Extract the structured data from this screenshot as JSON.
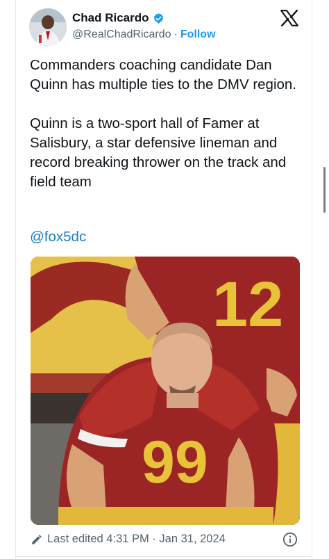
{
  "author": {
    "name": "Chad Ricardo",
    "handle": "@RealChadRicardo",
    "separator": "·",
    "follow_label": "Follow",
    "verified_icon": "verified-badge-icon",
    "brand_color": "#1d9bf0"
  },
  "post": {
    "paragraph_1": "Commanders coaching candidate Dan Quinn has multiple ties to the DMV region.",
    "paragraph_2": "Quinn is a two-sport hall of Famer at Salisbury, a star defensive lineman and record breaking thrower on the track and field team",
    "mention": "@fox5dc",
    "mention_color": "#1d7fc1"
  },
  "photo": {
    "jersey_back_number": "12",
    "jersey_front_number": "99",
    "jersey_color": "#9b2424",
    "number_color": "#e8c33a"
  },
  "footer": {
    "edit_icon": "pencil-icon",
    "edited_text": "Last edited 4:31 PM · Jan 31, 2024",
    "info_icon": "info-icon"
  }
}
